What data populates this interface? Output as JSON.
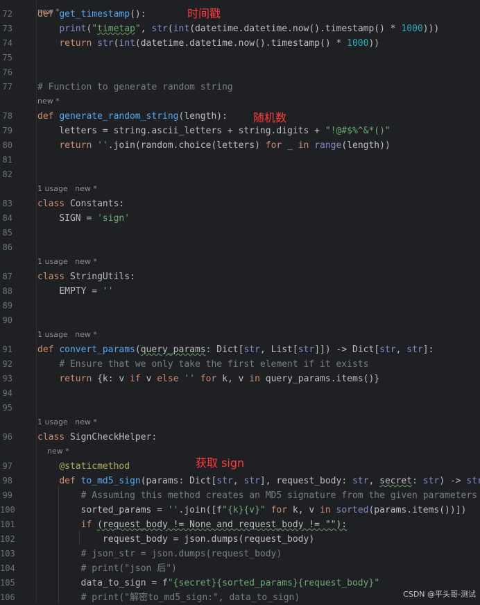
{
  "top_hint": "new *",
  "annotations": {
    "timestamp": "时间戳",
    "random_string": "随机数",
    "get_sign": "获取 sign"
  },
  "watermark": "CSDN @平头哥-测试",
  "lines": [
    {
      "num": "72",
      "tokens": [
        {
          "t": "def ",
          "c": "kw"
        },
        {
          "t": "get_timestamp",
          "c": "fn"
        },
        {
          "t": "():"
        }
      ]
    },
    {
      "num": "73",
      "tokens": [
        {
          "t": "    "
        },
        {
          "t": "print",
          "c": "bi"
        },
        {
          "t": "("
        },
        {
          "t": "\"",
          "c": "str"
        },
        {
          "t": "timetap",
          "c": "str squig"
        },
        {
          "t": "\"",
          "c": "str"
        },
        {
          "t": ", "
        },
        {
          "t": "str",
          "c": "bi"
        },
        {
          "t": "("
        },
        {
          "t": "int",
          "c": "bi"
        },
        {
          "t": "(datetime.datetime.now().timestamp() * "
        },
        {
          "t": "1000",
          "c": "num"
        },
        {
          "t": ")))"
        }
      ]
    },
    {
      "num": "74",
      "tokens": [
        {
          "t": "    "
        },
        {
          "t": "return ",
          "c": "kw"
        },
        {
          "t": "str",
          "c": "bi"
        },
        {
          "t": "("
        },
        {
          "t": "int",
          "c": "bi"
        },
        {
          "t": "(datetime.datetime.now().timestamp() * "
        },
        {
          "t": "1000",
          "c": "num"
        },
        {
          "t": "))"
        }
      ]
    },
    {
      "num": "75",
      "tokens": []
    },
    {
      "num": "76",
      "tokens": []
    },
    {
      "num": "77",
      "tokens": [
        {
          "t": "# Function to generate random string",
          "c": "cm"
        }
      ]
    },
    {
      "hint": "new *"
    },
    {
      "num": "78",
      "tokens": [
        {
          "t": "def ",
          "c": "kw"
        },
        {
          "t": "generate_random_string",
          "c": "fn"
        },
        {
          "t": "(length):"
        }
      ]
    },
    {
      "num": "79",
      "tokens": [
        {
          "t": "    letters = string.ascii_letters + string.digits + "
        },
        {
          "t": "\"!@#$%^&*()\"",
          "c": "str"
        }
      ]
    },
    {
      "num": "80",
      "tokens": [
        {
          "t": "    "
        },
        {
          "t": "return ",
          "c": "kw"
        },
        {
          "t": "''",
          "c": "str"
        },
        {
          "t": ".join(random.choice(letters) "
        },
        {
          "t": "for ",
          "c": "kw"
        },
        {
          "t": "_ "
        },
        {
          "t": "in ",
          "c": "kw"
        },
        {
          "t": "range",
          "c": "bi"
        },
        {
          "t": "(length))"
        }
      ]
    },
    {
      "num": "81",
      "tokens": []
    },
    {
      "num": "82",
      "tokens": []
    },
    {
      "hint": "1 usage   new *"
    },
    {
      "num": "83",
      "tokens": [
        {
          "t": "class ",
          "c": "kw"
        },
        {
          "t": "Constants:",
          "c": "cls"
        }
      ]
    },
    {
      "num": "84",
      "tokens": [
        {
          "t": "    SIGN = "
        },
        {
          "t": "'sign'",
          "c": "str"
        }
      ]
    },
    {
      "num": "85",
      "tokens": []
    },
    {
      "num": "86",
      "tokens": []
    },
    {
      "hint": "1 usage   new *"
    },
    {
      "num": "87",
      "tokens": [
        {
          "t": "class ",
          "c": "kw"
        },
        {
          "t": "StringUtils:",
          "c": "cls"
        }
      ]
    },
    {
      "num": "88",
      "tokens": [
        {
          "t": "    EMPTY = "
        },
        {
          "t": "''",
          "c": "str"
        }
      ]
    },
    {
      "num": "89",
      "tokens": []
    },
    {
      "num": "90",
      "tokens": []
    },
    {
      "hint": "1 usage   new *"
    },
    {
      "num": "91",
      "tokens": [
        {
          "t": "def ",
          "c": "kw"
        },
        {
          "t": "convert_params",
          "c": "fn"
        },
        {
          "t": "("
        },
        {
          "t": "query_params",
          "c": "squig"
        },
        {
          "t": ": Dict["
        },
        {
          "t": "str",
          "c": "bi"
        },
        {
          "t": ", List["
        },
        {
          "t": "str",
          "c": "bi"
        },
        {
          "t": "]]) -> Dict["
        },
        {
          "t": "str",
          "c": "bi"
        },
        {
          "t": ", "
        },
        {
          "t": "str",
          "c": "bi"
        },
        {
          "t": "]:"
        }
      ]
    },
    {
      "num": "92",
      "tokens": [
        {
          "t": "    "
        },
        {
          "t": "# Ensure that we only take the first element if it exists",
          "c": "cm"
        }
      ]
    },
    {
      "num": "93",
      "tokens": [
        {
          "t": "    "
        },
        {
          "t": "return ",
          "c": "kw"
        },
        {
          "t": "{k: v "
        },
        {
          "t": "if ",
          "c": "kw"
        },
        {
          "t": "v "
        },
        {
          "t": "else ",
          "c": "kw"
        },
        {
          "t": "'' ",
          "c": "str"
        },
        {
          "t": "for ",
          "c": "kw"
        },
        {
          "t": "k, v "
        },
        {
          "t": "in ",
          "c": "kw"
        },
        {
          "t": "query_params.items()}"
        }
      ]
    },
    {
      "num": "94",
      "tokens": []
    },
    {
      "num": "95",
      "tokens": []
    },
    {
      "hint": "1 usage   new *"
    },
    {
      "num": "96",
      "tokens": [
        {
          "t": "class ",
          "c": "kw"
        },
        {
          "t": "SignCheckHelper:",
          "c": "cls"
        }
      ]
    },
    {
      "hint": "    new *"
    },
    {
      "num": "97",
      "tokens": [
        {
          "t": "    "
        },
        {
          "t": "@staticmethod",
          "c": "dec"
        }
      ]
    },
    {
      "num": "98",
      "tokens": [
        {
          "t": "    "
        },
        {
          "t": "def ",
          "c": "kw"
        },
        {
          "t": "to_md5_sign",
          "c": "fn"
        },
        {
          "t": "(params: Dict["
        },
        {
          "t": "str",
          "c": "bi"
        },
        {
          "t": ", "
        },
        {
          "t": "str",
          "c": "bi"
        },
        {
          "t": "], request_body: "
        },
        {
          "t": "str",
          "c": "bi"
        },
        {
          "t": ", "
        },
        {
          "t": "secret",
          "c": "squig"
        },
        {
          "t": ": "
        },
        {
          "t": "str",
          "c": "bi"
        },
        {
          "t": ") -> "
        },
        {
          "t": "str",
          "c": "bi"
        },
        {
          "t": ":"
        }
      ]
    },
    {
      "num": "99",
      "tokens": [
        {
          "t": "        "
        },
        {
          "t": "# Assuming this method creates an MD5 signature from the given parameters",
          "c": "cm"
        }
      ]
    },
    {
      "num": "100",
      "tokens": [
        {
          "t": "        sorted_params = "
        },
        {
          "t": "''",
          "c": "str"
        },
        {
          "t": ".join([f"
        },
        {
          "t": "\"",
          "c": "str"
        },
        {
          "t": "{k}{v}",
          "c": "str"
        },
        {
          "t": "\" ",
          "c": "str"
        },
        {
          "t": "for ",
          "c": "kw"
        },
        {
          "t": "k, v "
        },
        {
          "t": "in ",
          "c": "kw"
        },
        {
          "t": "sorted",
          "c": "bi"
        },
        {
          "t": "(params.items())])"
        }
      ]
    },
    {
      "num": "101",
      "tokens": [
        {
          "t": "        "
        },
        {
          "t": "if ",
          "c": "kw"
        },
        {
          "t": "(request_body != None and request_body != \"\"):",
          "c": "squig"
        }
      ]
    },
    {
      "num": "102",
      "tokens": [
        {
          "t": "            request_body = json.dumps(request_body)"
        }
      ]
    },
    {
      "num": "103",
      "tokens": [
        {
          "t": "        "
        },
        {
          "t": "# json_str = json.dumps(request_body)",
          "c": "cm"
        }
      ]
    },
    {
      "num": "104",
      "tokens": [
        {
          "t": "        "
        },
        {
          "t": "# print(\"json 后\")",
          "c": "cm"
        }
      ]
    },
    {
      "num": "105",
      "tokens": [
        {
          "t": "        data_to_sign = f"
        },
        {
          "t": "\"{secret}{sorted_params}{request_body}\"",
          "c": "str"
        }
      ]
    },
    {
      "num": "106",
      "tokens": [
        {
          "t": "        "
        },
        {
          "t": "# print(\"解密to_md5_sign:\", data_to_sign)",
          "c": "cm"
        }
      ]
    }
  ]
}
